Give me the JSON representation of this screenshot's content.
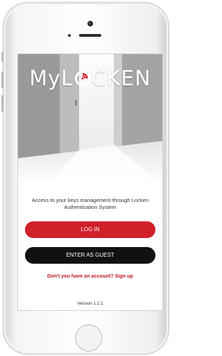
{
  "app": {
    "logo_text_left": "My",
    "logo_text_right": "CKEN",
    "logo_text_l": "L",
    "logo_accent_color": "#d0202a",
    "tagline": "Access to your keys management through Locken Authentication System",
    "login_label": "LOG IN",
    "guest_label": "ENTER AS GUEST",
    "signup_label": "Don't you have an account? Sign up",
    "version": "Version 1.2.2"
  },
  "colors": {
    "primary": "#d0202a",
    "dark_button": "#111111"
  }
}
